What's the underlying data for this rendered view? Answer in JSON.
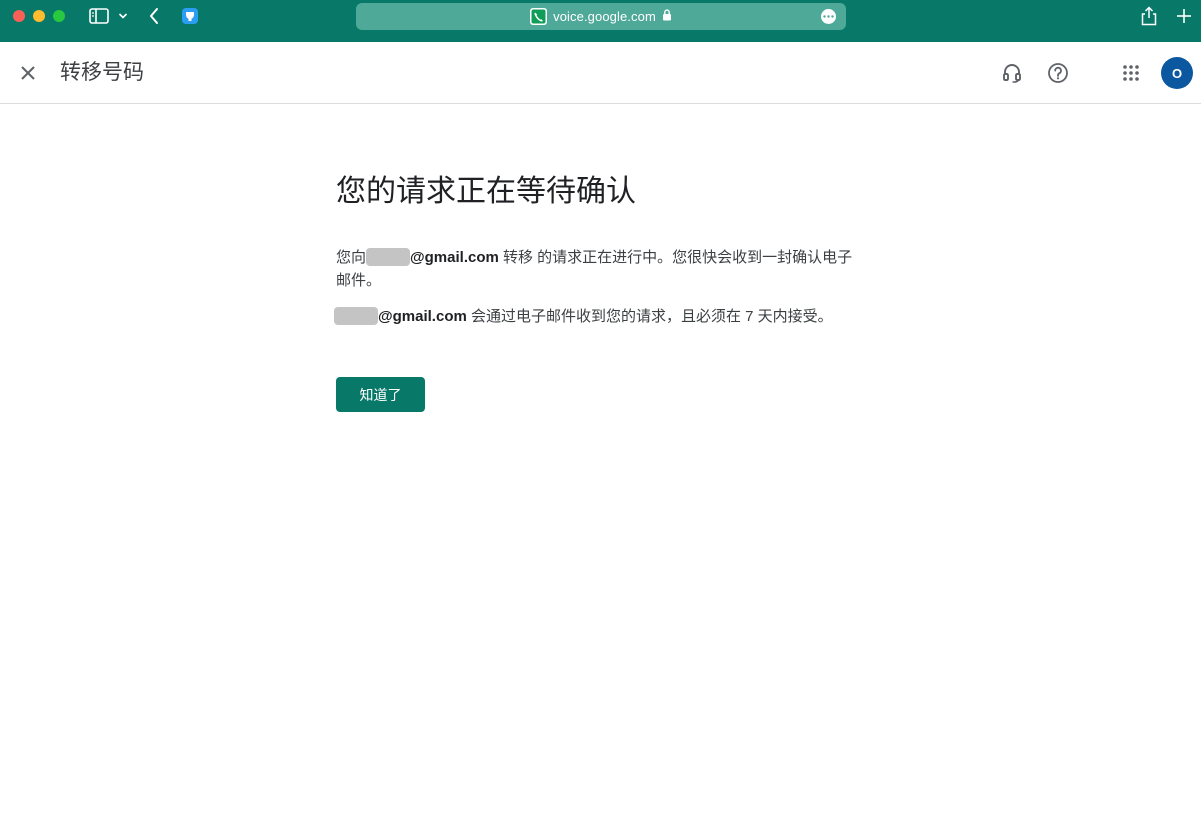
{
  "browser": {
    "url": "voice.google.com"
  },
  "header": {
    "title": "转移号码",
    "avatar_initial": "O"
  },
  "dialog": {
    "heading": "您的请求正在等待确认",
    "para1": {
      "prefix": "您向",
      "email_domain": "@gmail.com",
      "suffix": " 转移 的请求正在进行中。您很快会收到一封确认电子邮件。"
    },
    "para2": {
      "email_domain": "@gmail.com",
      "suffix": " 会通过电子邮件收到您的请求，且必须在 7 天内接受。"
    },
    "button_label": "知道了"
  },
  "colors": {
    "brand": "#087868",
    "avatar": "#0b57a0"
  }
}
